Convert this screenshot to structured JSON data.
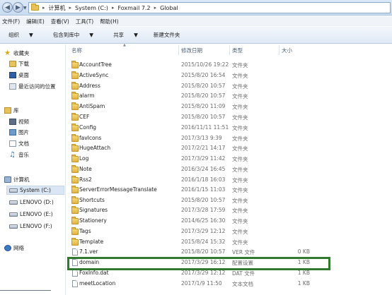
{
  "address": {
    "crumbs": [
      "计算机",
      "System (C:)",
      "Foxmail 7.2",
      "Global"
    ]
  },
  "menu": [
    "文件(F)",
    "编辑(E)",
    "查看(V)",
    "工具(T)",
    "帮助(H)"
  ],
  "toolbar": {
    "organize": "组织",
    "include_library": "包含到库中",
    "share": "共享",
    "new_folder": "新建文件夹"
  },
  "nav": {
    "favorites": "收藏夹",
    "downloads": "下载",
    "desktop": "桌面",
    "recent": "最近访问的位置",
    "libraries": "库",
    "videos": "视频",
    "pictures": "图片",
    "documents": "文档",
    "music": "音乐",
    "computer": "计算机",
    "drive_c": "System (C:)",
    "drive_d": "LENOVO (D:)",
    "drive_e": "LENOVO (E:)",
    "drive_f": "LENOVO (F:)",
    "network": "网络"
  },
  "columns": {
    "name": "名称",
    "date": "修改日期",
    "type": "类型",
    "size": "大小"
  },
  "files": [
    {
      "name": "AccountTree",
      "date": "2015/10/26 19:22",
      "type": "文件夹",
      "size": "",
      "kind": "folder"
    },
    {
      "name": "ActiveSync",
      "date": "2015/8/20 16:54",
      "type": "文件夹",
      "size": "",
      "kind": "folder"
    },
    {
      "name": "Address",
      "date": "2015/8/20 10:57",
      "type": "文件夹",
      "size": "",
      "kind": "folder"
    },
    {
      "name": "alarm",
      "date": "2015/8/20 10:57",
      "type": "文件夹",
      "size": "",
      "kind": "folder"
    },
    {
      "name": "AntiSpam",
      "date": "2015/8/20 11:09",
      "type": "文件夹",
      "size": "",
      "kind": "folder"
    },
    {
      "name": "CEF",
      "date": "2015/8/20 10:57",
      "type": "文件夹",
      "size": "",
      "kind": "folder"
    },
    {
      "name": "Config",
      "date": "2016/11/11 11:51",
      "type": "文件夹",
      "size": "",
      "kind": "folder"
    },
    {
      "name": "favIcons",
      "date": "2017/3/13 9:39",
      "type": "文件夹",
      "size": "",
      "kind": "folder"
    },
    {
      "name": "HugeAttach",
      "date": "2017/2/21 14:17",
      "type": "文件夹",
      "size": "",
      "kind": "folder"
    },
    {
      "name": "Log",
      "date": "2017/3/29 11:42",
      "type": "文件夹",
      "size": "",
      "kind": "folder"
    },
    {
      "name": "Note",
      "date": "2016/3/24 16:45",
      "type": "文件夹",
      "size": "",
      "kind": "folder"
    },
    {
      "name": "Rss2",
      "date": "2016/1/18 16:03",
      "type": "文件夹",
      "size": "",
      "kind": "folder"
    },
    {
      "name": "ServerErrorMessageTranslate",
      "date": "2016/1/15 11:03",
      "type": "文件夹",
      "size": "",
      "kind": "folder"
    },
    {
      "name": "Shortcuts",
      "date": "2015/8/20 10:57",
      "type": "文件夹",
      "size": "",
      "kind": "folder"
    },
    {
      "name": "Signatures",
      "date": "2017/3/28 17:59",
      "type": "文件夹",
      "size": "",
      "kind": "folder"
    },
    {
      "name": "Stationery",
      "date": "2014/6/25 16:30",
      "type": "文件夹",
      "size": "",
      "kind": "folder"
    },
    {
      "name": "Tags",
      "date": "2017/3/29 12:12",
      "type": "文件夹",
      "size": "",
      "kind": "folder"
    },
    {
      "name": "Template",
      "date": "2015/8/24 15:32",
      "type": "文件夹",
      "size": "",
      "kind": "folder"
    },
    {
      "name": "7.1.ver",
      "date": "2015/8/20 10:57",
      "type": "VER 文件",
      "size": "0 KB",
      "kind": "file"
    },
    {
      "name": "domain",
      "date": "2017/3/29 16:12",
      "type": "配置设置",
      "size": "1 KB",
      "kind": "file"
    },
    {
      "name": "FoxInfo.dat",
      "date": "2017/3/29 12:12",
      "type": "DAT 文件",
      "size": "1 KB",
      "kind": "file"
    },
    {
      "name": "meetLocation",
      "date": "2017/1/9 11:50",
      "type": "文本文档",
      "size": "1 KB",
      "kind": "file"
    }
  ]
}
